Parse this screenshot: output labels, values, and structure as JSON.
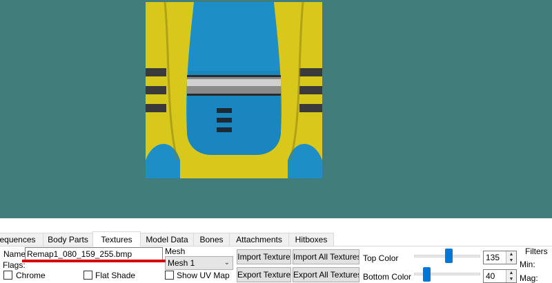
{
  "tabs": [
    "Sequences",
    "Body Parts",
    "Textures",
    "Model Data",
    "Bones",
    "Attachments",
    "Hitboxes"
  ],
  "textures": {
    "name_label": "Name:",
    "name_value": "Remap1_080_159_255.bmp",
    "flags_label": "Flags:",
    "mesh_label": "Mesh",
    "mesh_value": "Mesh 1",
    "chrome_label": "Chrome",
    "flat_shade_label": "Flat Shade",
    "show_uv_label": "Show UV Map",
    "import_texture": "Import Texture",
    "import_all_textures": "Import All Textures",
    "export_texture": "Export Texture",
    "export_all_textures": "Export All Textures",
    "top_color_label": "Top Color",
    "top_color_value": "135",
    "bottom_color_label": "Bottom Color",
    "bottom_color_value": "40",
    "filters_label": "Filters",
    "min_label": "Min:",
    "mag_label": "Mag:"
  },
  "slider_max": 255,
  "colors": {
    "viewport_bg": "#417d7b",
    "accent": "#0078d7",
    "texture_yellow": "#e0cf1e",
    "texture_blue": "#1e93c9"
  }
}
